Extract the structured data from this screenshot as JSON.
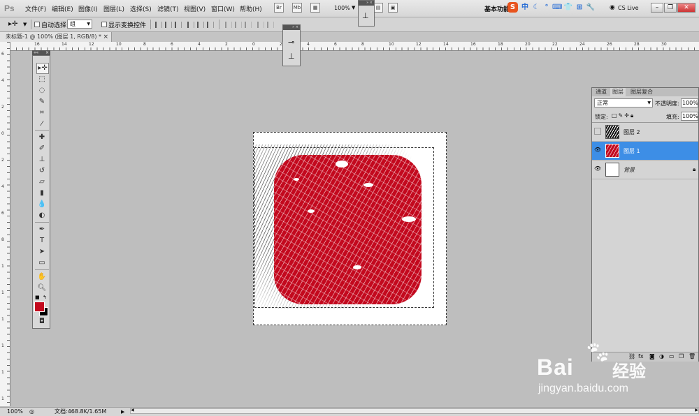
{
  "app": {
    "logo": "Ps"
  },
  "menubar": {
    "menus": [
      "文件(F)",
      "编辑(E)",
      "图像(I)",
      "图层(L)",
      "选择(S)",
      "滤镜(T)",
      "视图(V)",
      "窗口(W)",
      "帮助(H)"
    ],
    "br_label": "Br",
    "mb_label": "Mb",
    "zoom": "100%",
    "workspace": "基本功能",
    "cs_live": "CS Live",
    "ime_label": "中"
  },
  "options": {
    "auto_select_label": "自动选择:",
    "auto_select_value": "组",
    "show_transform_label": "显示变换控件"
  },
  "document": {
    "tab_title": "未标题-1 @ 100% (图层 1, RGB/8) *",
    "close": "×"
  },
  "ruler": {
    "top_numbers": [
      "16",
      "14",
      "12",
      "10",
      "8",
      "6",
      "4",
      "2",
      "0",
      "2",
      "4",
      "6",
      "8",
      "10",
      "12",
      "14",
      "16",
      "18",
      "20",
      "22",
      "24",
      "26",
      "28",
      "30"
    ],
    "left_numbers": [
      "6",
      "4",
      "2",
      "0",
      "2",
      "4",
      "6",
      "8",
      "1",
      "1",
      "1",
      "1",
      "1",
      "1"
    ]
  },
  "layers_panel": {
    "tabs": [
      "通道",
      "图层",
      "图层复合"
    ],
    "active_tab": "图层",
    "blend_mode": "正常",
    "opacity_label": "不透明度:",
    "opacity_value": "100%",
    "lock_label": "锁定:",
    "fill_label": "填充:",
    "fill_value": "100%",
    "layers": [
      {
        "name": "图层 2",
        "visible": false,
        "selected": false
      },
      {
        "name": "图层 1",
        "visible": true,
        "selected": true
      },
      {
        "name": "背景",
        "visible": true,
        "selected": false,
        "locked": true
      }
    ]
  },
  "status": {
    "zoom": "100%",
    "doc_info": "文档:468.8K/1.65M"
  },
  "watermark": {
    "brand": "Bai",
    "brand2": "经验",
    "url": "jingyan.baidu.com"
  },
  "colors": {
    "foreground": "#c3091e",
    "background": "#000000",
    "selection_blue": "#3d8ee6"
  }
}
